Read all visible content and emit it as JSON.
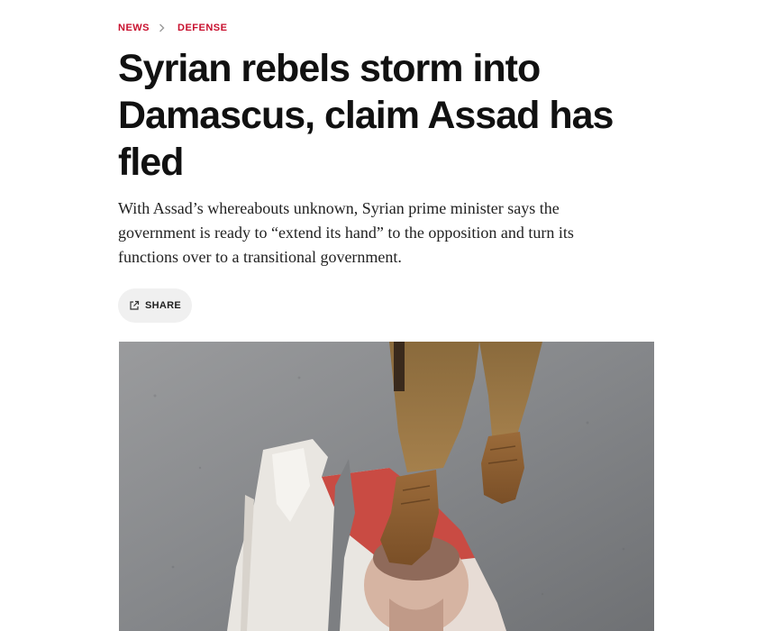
{
  "breadcrumb": {
    "section": "NEWS",
    "subsection": "DEFENSE"
  },
  "article": {
    "headline": "Syrian rebels storm into Damascus, claim Assad has fled",
    "dek": "With Assad’s whereabouts unknown, Syrian prime minister says the government is ready to “extend its hand” to the opposition and turn its functions over to a transitional government.",
    "share_label": "SHARE"
  },
  "icons": {
    "breadcrumb_separator": "chevron-right-icon",
    "share": "external-link-icon"
  },
  "colors": {
    "accent": "#c8102e",
    "headline": "#111111",
    "body": "#222222",
    "share_bg": "#f0f0f0"
  }
}
